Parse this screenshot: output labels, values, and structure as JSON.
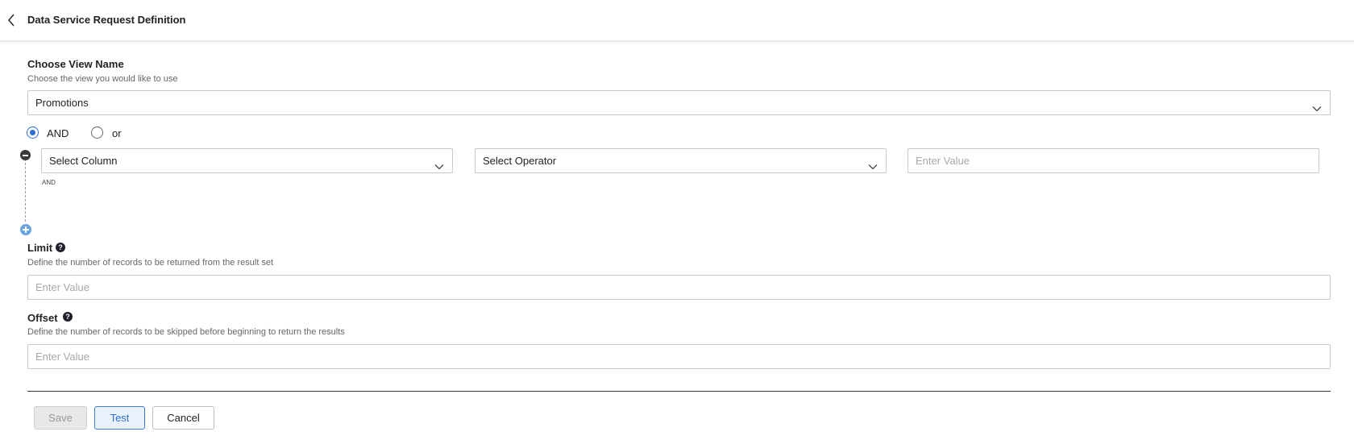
{
  "header": {
    "title": "Data Service Request Definition"
  },
  "view": {
    "label": "Choose View Name",
    "description": "Choose the view you would like to use",
    "selected": "Promotions"
  },
  "logic": {
    "options": [
      {
        "label": "AND",
        "checked": true
      },
      {
        "label": "or",
        "checked": false
      }
    ]
  },
  "condition": {
    "column_placeholder": "Select Column",
    "operator_placeholder": "Select Operator",
    "value_placeholder": "Enter Value",
    "connector": "AND"
  },
  "limit": {
    "label": "Limit",
    "description": "Define the number of records to be returned from the result set",
    "placeholder": "Enter Value"
  },
  "offset": {
    "label": "Offset",
    "description": "Define the number of records to be skipped before beginning to return the results",
    "placeholder": "Enter Value"
  },
  "actions": {
    "save": "Save",
    "test": "Test",
    "cancel": "Cancel"
  },
  "colors": {
    "accent": "#2d6fd1",
    "add_icon": "#6ba3e0"
  }
}
